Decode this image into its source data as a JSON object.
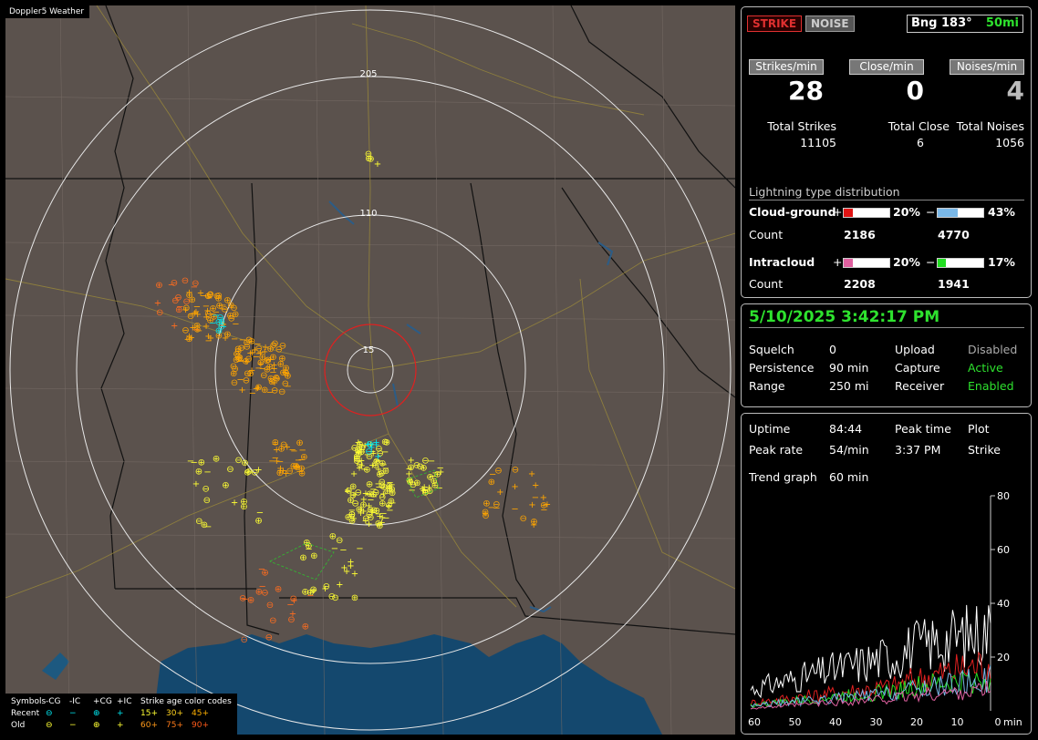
{
  "map": {
    "title": "Doppler5 Weather",
    "range_labels": [
      "205",
      "110",
      "15"
    ],
    "legend": {
      "header": [
        "Symbols",
        "-CG",
        "-IC",
        "+CG",
        "+IC",
        "Strike age color codes"
      ],
      "recent": [
        "Recent",
        "15+",
        "30+",
        "45+"
      ],
      "old": [
        "Old",
        "60+",
        "75+",
        "90+"
      ]
    }
  },
  "top": {
    "strike_button": "STRIKE",
    "noise_button": "NOISE",
    "bearing": "Bng 183°",
    "range": "50mi"
  },
  "rates": {
    "strikes_label": "Strikes/min",
    "close_label": "Close/min",
    "noises_label": "Noises/min",
    "strikes": "28",
    "close": "0",
    "noises": "4",
    "total_strikes_label": "Total Strikes",
    "total_close_label": "Total Close",
    "total_noises_label": "Total Noises",
    "total_strikes": "11105",
    "total_close": "6",
    "total_noises": "1056"
  },
  "distribution": {
    "title": "Lightning type distribution",
    "cg_label": "Cloud-ground",
    "ic_label": "Intracloud",
    "count_label": "Count",
    "plus": "+",
    "minus": "−",
    "cg_pos_pct": "20%",
    "cg_neg_pct": "43%",
    "cg_pos_count": "2186",
    "cg_neg_count": "4770",
    "ic_pos_pct": "20%",
    "ic_neg_pct": "17%",
    "ic_pos_count": "2208",
    "ic_neg_count": "1941",
    "cg_pos_frac": 0.2,
    "cg_neg_frac": 0.43,
    "ic_pos_frac": 0.2,
    "ic_neg_frac": 0.17
  },
  "status": {
    "datetime": "5/10/2025 3:42:17 PM",
    "squelch_label": "Squelch",
    "squelch": "0",
    "persistence_label": "Persistence",
    "persistence": "90 min",
    "range_label": "Range",
    "range": "250 mi",
    "upload_label": "Upload",
    "upload": "Disabled",
    "capture_label": "Capture",
    "capture": "Active",
    "receiver_label": "Receiver",
    "receiver": "Enabled"
  },
  "stats": {
    "uptime_label": "Uptime",
    "uptime": "84:44",
    "peak_time_label": "Peak time",
    "peak_time": "3:37 PM",
    "plot_label": "Plot",
    "plot": "Strike",
    "peak_rate_label": "Peak rate",
    "peak_rate": "54/min",
    "trend_label": "Trend graph",
    "trend": "60 min",
    "x_ticks": [
      "60",
      "50",
      "40",
      "30",
      "20",
      "10",
      "0"
    ],
    "x_unit": "min",
    "y_ticks": [
      "80",
      "60",
      "40",
      "20"
    ]
  },
  "colors": {
    "map_bg": "#5b524d",
    "gulf": "#14486e",
    "strike_recent": "#ffff33",
    "strike_mid": "#ffa500",
    "strike_old": "#ff6d1f",
    "cyan": "#00e5ee",
    "accent_green": "#2ee22e",
    "strike_red": "#e03030"
  }
}
